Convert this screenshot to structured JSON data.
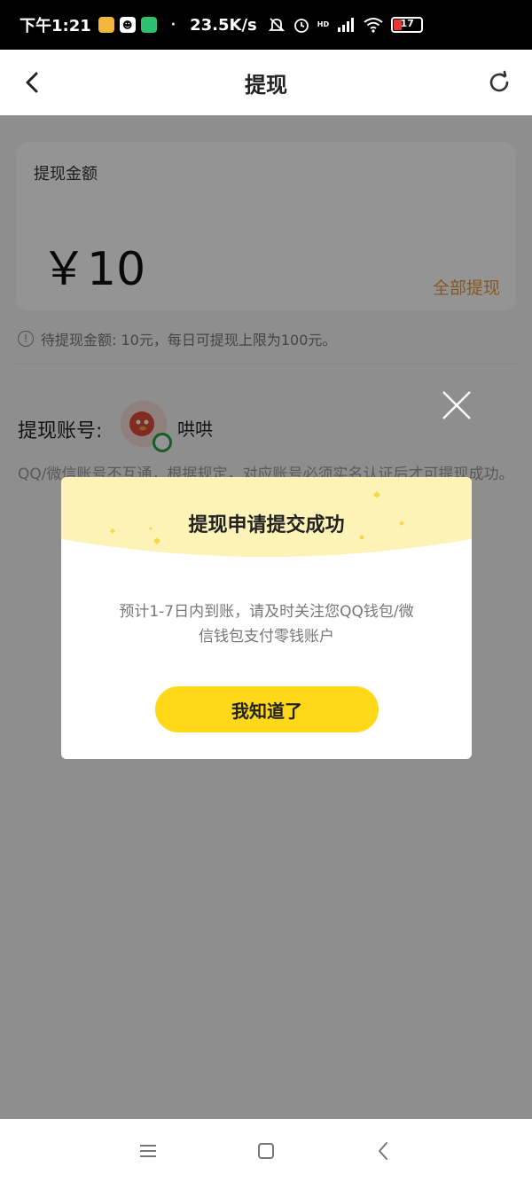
{
  "status_bar": {
    "time": "下午1:21",
    "network_speed": "23.5K/s",
    "network_type": "HD",
    "battery": "17",
    "icons": [
      "app-notification-icon",
      "avatar-app-icon",
      "shield-app-icon",
      "mute-icon",
      "alarm-icon",
      "signal-icon",
      "wifi-icon",
      "battery-icon"
    ]
  },
  "nav": {
    "title": "提现",
    "back_icon": "chevron-left-icon",
    "refresh_icon": "refresh-icon"
  },
  "amount_card": {
    "label": "提现金额",
    "amount": "￥10",
    "withdraw_all": "全部提现"
  },
  "hint": "待提现金额: 10元，每日可提现上限为100元。",
  "account": {
    "label": "提现账号:",
    "name": "哄哄",
    "note": "QQ/微信账号不互通，根据规定，对应账号必须实名认证后才可提现成功。"
  },
  "dialog": {
    "title": "提现申请提交成功",
    "message": "预计1-7日内到账，请及时关注您QQ钱包/微信钱包支付零钱账户",
    "button": "我知道了"
  },
  "colors": {
    "accent_yellow": "#ffd81a",
    "withdraw_all_orange": "#e8963a",
    "banner_yellow": "#fbefa6"
  }
}
